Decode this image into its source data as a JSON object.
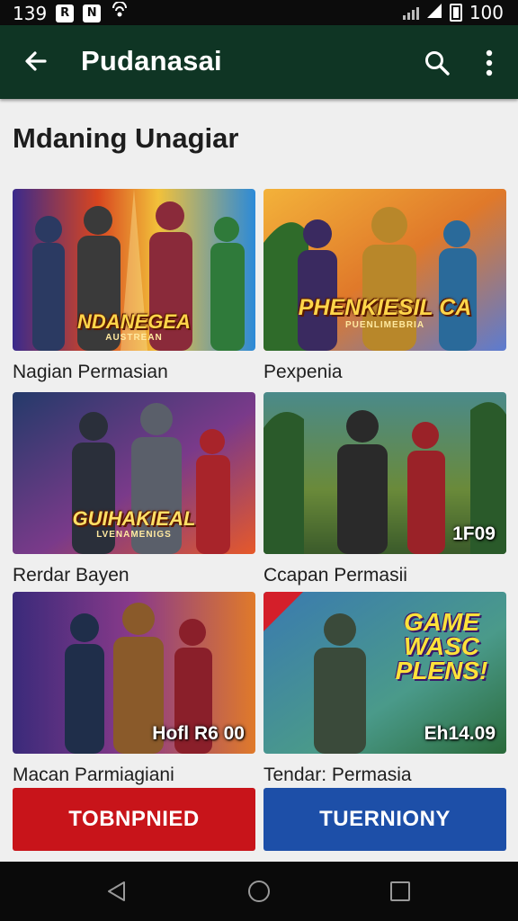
{
  "status_bar": {
    "time": "139",
    "battery": "100",
    "left_icons": [
      "R",
      "N"
    ]
  },
  "app_bar": {
    "title": "Pudanasai"
  },
  "section": {
    "title": "Mdaning Unagiar"
  },
  "cards": [
    {
      "title": "Nagian Permasian",
      "image_caption": "NDANEGEA",
      "image_subcaption": "AUSTREAN"
    },
    {
      "title": "Pexpenia",
      "image_caption": "PHENKIESIL CA",
      "image_subcaption": "PUENLIMEBRIA"
    },
    {
      "title": "Rerdar Bayen",
      "image_caption": "GUIHAKIEAL",
      "image_subcaption": "LVENAMENIGS"
    },
    {
      "title": "Ccapan Permasii",
      "badge": "1F09"
    },
    {
      "title": "Macan Parmiagiani",
      "badge": "Hofl R6 00"
    },
    {
      "title": "Tendar: Permasia",
      "badge": "Eh14.09",
      "image_caption": "GAME WASC PLENS!"
    }
  ],
  "buttons": {
    "primary": "TOBNPNIED",
    "secondary": "TUERNIONY"
  },
  "colors": {
    "app_bar": "#0f3524",
    "primary_button": "#c8141a",
    "secondary_button": "#1d4fa8",
    "background": "#efefef"
  }
}
